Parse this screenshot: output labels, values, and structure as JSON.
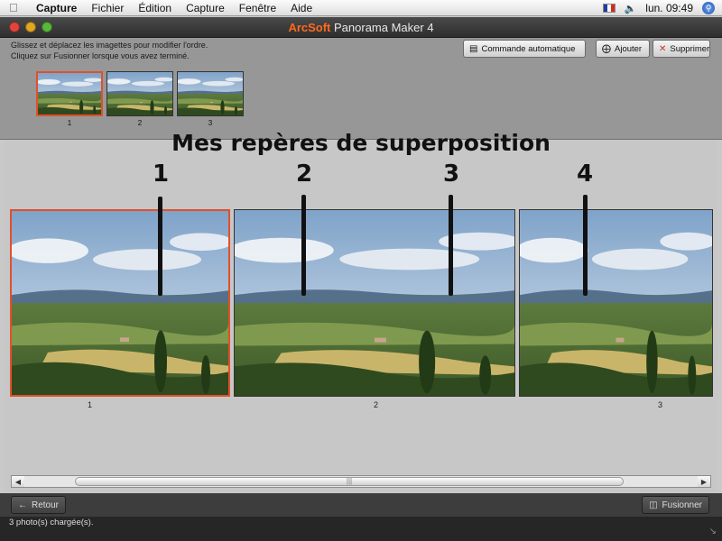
{
  "menubar": {
    "items": [
      {
        "label": "Capture",
        "bold": true
      },
      {
        "label": "Fichier"
      },
      {
        "label": "Édition"
      },
      {
        "label": "Capture"
      },
      {
        "label": "Fenêtre"
      },
      {
        "label": "Aide"
      }
    ],
    "clock": "lun. 09:49"
  },
  "window": {
    "title_brand": "ArcSoft",
    "title_rest": " Panorama Maker 4"
  },
  "toolbar": {
    "instruction_line1": "Glissez et déplacez les imagettes pour modifier l'ordre.",
    "instruction_line2": "Cliquez sur Fusionner lorsque vous avez terminé.",
    "auto_label": "Commande automatique",
    "add_label": "Ajouter",
    "delete_label": "Supprimer"
  },
  "thumbnails": [
    {
      "number": "1",
      "selected": true
    },
    {
      "number": "2",
      "selected": false
    },
    {
      "number": "3",
      "selected": false
    }
  ],
  "annotation": {
    "title": "Mes repères de superposition",
    "markers": [
      "1",
      "2",
      "3",
      "4"
    ]
  },
  "photos": [
    {
      "label": "1",
      "selected": true
    },
    {
      "label": "2",
      "selected": false
    },
    {
      "label": "3",
      "selected": false
    }
  ],
  "footer": {
    "back_label": "Retour",
    "merge_label": "Fusionner",
    "status": "3 photo(s) chargée(s)."
  },
  "colors": {
    "accent": "#e2502a",
    "brand": "#ff6a1a"
  },
  "icons": {
    "apple": "apple-icon",
    "volume": "speaker-icon",
    "spotlight": "spotlight-icon",
    "add": "add-photo-icon",
    "delete": "delete-x-icon",
    "auto": "auto-command-icon",
    "back": "arrow-left-icon",
    "merge": "merge-icon"
  }
}
